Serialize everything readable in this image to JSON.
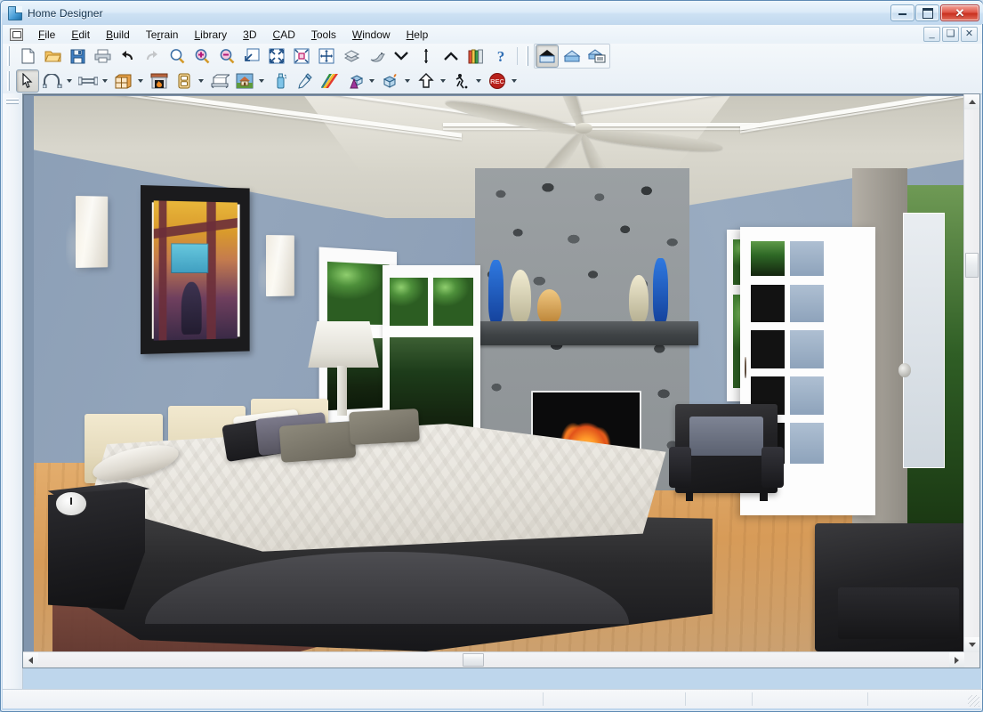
{
  "window": {
    "title": "Home Designer",
    "app_icon": "document-blue-icon",
    "controls": {
      "minimize": "minimize-button",
      "maximize": "maximize-button",
      "close": "✕"
    }
  },
  "menu": {
    "app_menu_icon": "app-control-icon",
    "items": [
      {
        "label": "File",
        "accel": "F"
      },
      {
        "label": "Edit",
        "accel": "E"
      },
      {
        "label": "Build",
        "accel": "B"
      },
      {
        "label": "Terrain",
        "accel": "r"
      },
      {
        "label": "Library",
        "accel": "L"
      },
      {
        "label": "3D",
        "accel": "3"
      },
      {
        "label": "CAD",
        "accel": "C"
      },
      {
        "label": "Tools",
        "accel": "T"
      },
      {
        "label": "Window",
        "accel": "W"
      },
      {
        "label": "Help",
        "accel": "H"
      }
    ],
    "mdi_controls": {
      "minimize": "_",
      "restore": "❐",
      "close": "✕"
    }
  },
  "toolbars": {
    "row1": [
      {
        "name": "new-plan-button",
        "icon": "new-page-icon",
        "label": "New Plan"
      },
      {
        "name": "open-plan-button",
        "icon": "open-folder-icon",
        "label": "Open Plan"
      },
      {
        "name": "save-plan-button",
        "icon": "save-floppy-icon",
        "label": "Save Plan"
      },
      {
        "name": "print-button",
        "icon": "printer-icon",
        "label": "Print"
      },
      {
        "name": "undo-button",
        "icon": "undo-arrow-icon",
        "label": "Undo"
      },
      {
        "name": "redo-button",
        "icon": "redo-arrow-icon",
        "label": "Redo",
        "disabled": true
      },
      {
        "name": "zoom-button",
        "icon": "magnifier-icon",
        "label": "Zoom"
      },
      {
        "name": "zoom-in-button",
        "icon": "magnifier-plus-icon",
        "label": "Zoom In"
      },
      {
        "name": "zoom-out-button",
        "icon": "magnifier-minus-icon",
        "label": "Zoom Out"
      },
      {
        "name": "fill-window-button",
        "icon": "fill-window-icon",
        "label": "Fill Window"
      },
      {
        "name": "zoom-extents-button",
        "icon": "zoom-extents-icon",
        "label": "Zoom Extents"
      },
      {
        "name": "zoom-selection-button",
        "icon": "zoom-selection-icon",
        "label": "Zoom to Selection"
      },
      {
        "name": "pan-button",
        "icon": "pan-move-icon",
        "label": "Pan Window"
      },
      {
        "name": "reference-display-button",
        "icon": "layers-icon",
        "label": "Reference Display"
      },
      {
        "name": "swap-view-button",
        "icon": "swap-bird-icon",
        "label": "Swap Views"
      },
      {
        "name": "down-one-floor-button",
        "icon": "chevron-down-icon",
        "label": "Down One Floor"
      },
      {
        "name": "floor-reference-button",
        "icon": "vertical-line-icon",
        "label": "Floor Reference"
      },
      {
        "name": "up-one-floor-button",
        "icon": "chevron-up-icon",
        "label": "Up One Floor"
      },
      {
        "name": "library-browser-button",
        "icon": "books-icon",
        "label": "Library Browser"
      },
      {
        "name": "help-button",
        "icon": "question-mark-icon",
        "label": "Help"
      }
    ],
    "row1_group2": [
      {
        "name": "full-overview-button",
        "icon": "house-dark-roof-icon",
        "label": "Full Overview",
        "active": true
      },
      {
        "name": "framing-overview-button",
        "icon": "house-blue-icon",
        "label": "Framing Overview"
      },
      {
        "name": "material-list-button",
        "icon": "house-list-icon",
        "label": "Material List"
      }
    ],
    "row2": [
      {
        "name": "select-objects-button",
        "icon": "arrow-cursor-icon",
        "label": "Select Objects",
        "active": true
      },
      {
        "name": "wall-tools-button",
        "icon": "wall-curve-icon",
        "label": "Wall Tools",
        "caret": true
      },
      {
        "name": "railing-tools-button",
        "icon": "railing-icon",
        "label": "Railing Tools",
        "caret": true
      },
      {
        "name": "cabinet-tools-button",
        "icon": "cabinet-icon",
        "label": "Cabinet Tools",
        "caret": true
      },
      {
        "name": "fireplace-button",
        "icon": "fireplace-icon",
        "label": "Fireplace"
      },
      {
        "name": "electrical-button",
        "icon": "outlet-icon",
        "label": "Electrical",
        "caret": true
      },
      {
        "name": "furniture-button",
        "icon": "furniture-icon",
        "label": "Furniture"
      },
      {
        "name": "exterior-button",
        "icon": "house-scene-icon",
        "label": "Exterior",
        "caret": true
      },
      {
        "name": "material-painter-button",
        "icon": "spray-can-icon",
        "label": "Material Painter"
      },
      {
        "name": "material-eyedropper-button",
        "icon": "eyedropper-icon",
        "label": "Material Eyedropper"
      },
      {
        "name": "material-list-stripe-button",
        "icon": "rainbow-stripes-icon",
        "label": "Materials"
      },
      {
        "name": "terrain-tools-button",
        "icon": "terrain-cone-icon",
        "label": "Terrain Tools",
        "caret": true
      },
      {
        "name": "plant-tools-button",
        "icon": "plant-box-icon",
        "label": "Plant Tools",
        "caret": true
      },
      {
        "name": "camera-button",
        "icon": "up-arrow-outline-icon",
        "label": "Full Camera",
        "caret": true
      },
      {
        "name": "walkthrough-button",
        "icon": "walkthrough-person-icon",
        "label": "Walkthrough",
        "caret": true
      },
      {
        "name": "record-walkthrough-button",
        "icon": "record-rec-icon",
        "label": "Record Walkthrough",
        "caret": true
      }
    ]
  },
  "left_toolbar": {
    "name": "left-docked-toolbar",
    "grip": "toolbar-grip"
  },
  "viewport": {
    "name": "3d-camera-view",
    "scene": "Bedroom 3D perspective render",
    "colors": {
      "wall": "#8fa1b7",
      "ceiling": "#d4d2c7",
      "trim": "#fbfbf8",
      "floor": "#d79b58",
      "stone": "#4c5053",
      "mantel": "#3f4346",
      "bedding": "#e8e5de",
      "headboard": "#e6dcbe",
      "chair": "#222225",
      "foliage": "#2f6a28",
      "fire": "#ff9b2a"
    },
    "vases": [
      {
        "name": "vase-blue-left",
        "color": "#1f5fc4"
      },
      {
        "name": "vase-cream-left",
        "color": "#d8d3b8"
      },
      {
        "name": "vase-gold",
        "color": "#d9a85c"
      },
      {
        "name": "vase-cream-right",
        "color": "#d6d1b5"
      },
      {
        "name": "vase-blue-right",
        "color": "#1f5fc4"
      }
    ]
  },
  "scrollbars": {
    "vertical": {
      "name": "vertical-scrollbar",
      "up": "▲",
      "down": "▼"
    },
    "horizontal": {
      "name": "horizontal-scrollbar",
      "left": "◀",
      "right": "▶"
    }
  },
  "statusbar": {
    "cells": [
      "",
      "",
      "",
      "",
      ""
    ]
  }
}
